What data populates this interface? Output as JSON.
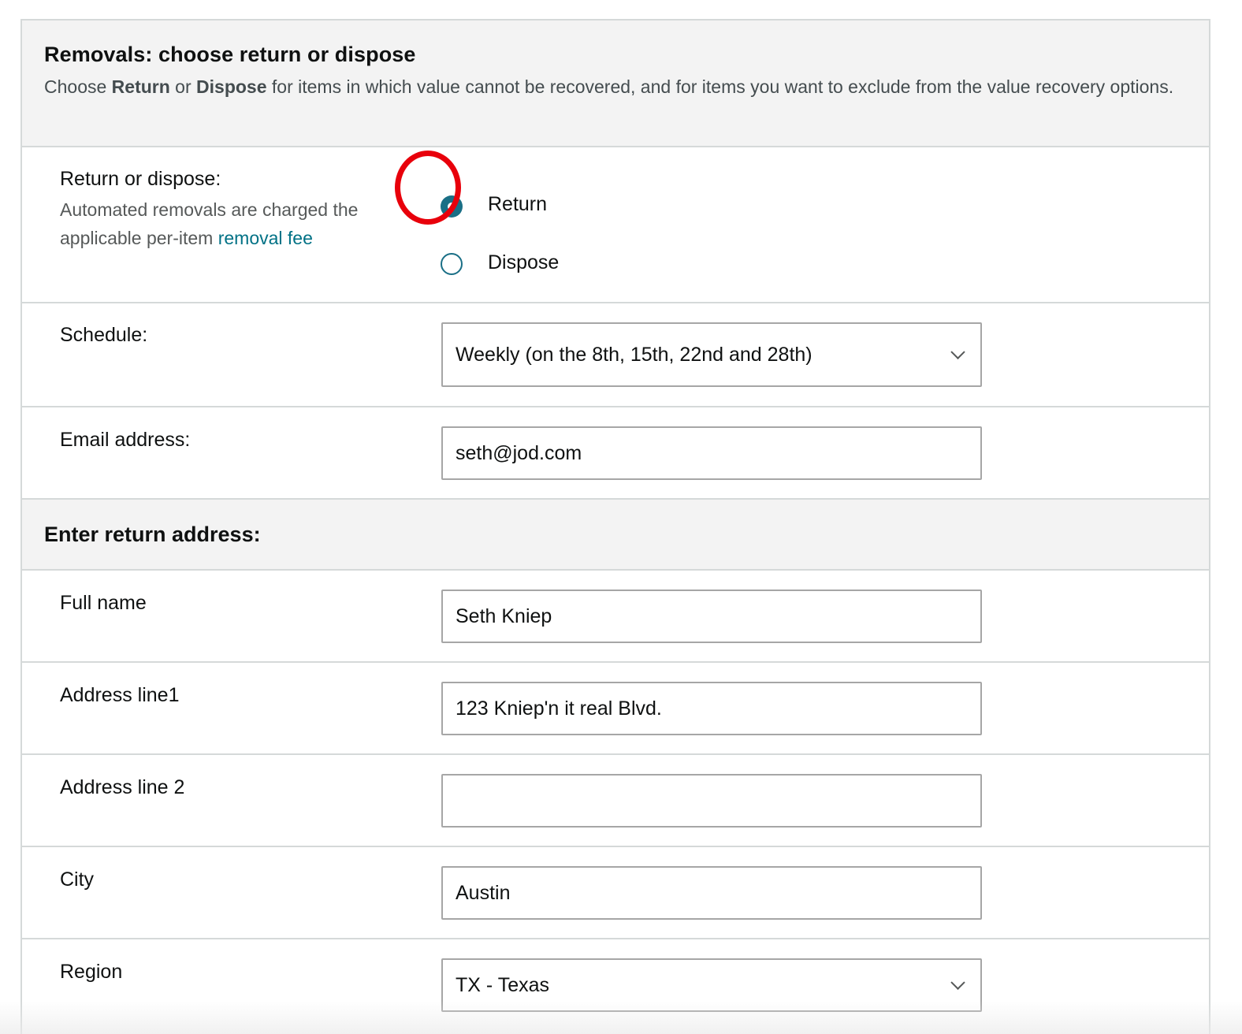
{
  "header": {
    "title": "Removals: choose return or dispose",
    "desc_pre": "Choose ",
    "desc_return": "Return",
    "desc_or": " or ",
    "desc_dispose": "Dispose",
    "desc_post": " for items in which value cannot be recovered, and for items you want to exclude from the value recovery options."
  },
  "return_or_dispose": {
    "label": "Return or dispose:",
    "sub_text": "Automated removals are charged the applicable per-item ",
    "link_text": "removal fee",
    "options": [
      {
        "label": "Return",
        "selected": true
      },
      {
        "label": "Dispose",
        "selected": false
      }
    ],
    "accent_color": "#1a6f86",
    "highlight_color": "#e8000b"
  },
  "schedule": {
    "label": "Schedule:",
    "value": "Weekly (on the 8th, 15th, 22nd and 28th)"
  },
  "email": {
    "label": "Email address:",
    "value": "seth@jod.com"
  },
  "return_address": {
    "title": "Enter return address:",
    "full_name": {
      "label": "Full name",
      "value": "Seth Kniep"
    },
    "address_line1": {
      "label": "Address line1",
      "value": "123 Kniep'n it real Blvd."
    },
    "address_line2": {
      "label": "Address line 2",
      "value": ""
    },
    "city": {
      "label": "City",
      "value": "Austin"
    },
    "region": {
      "label": "Region",
      "value": "TX - Texas"
    }
  }
}
